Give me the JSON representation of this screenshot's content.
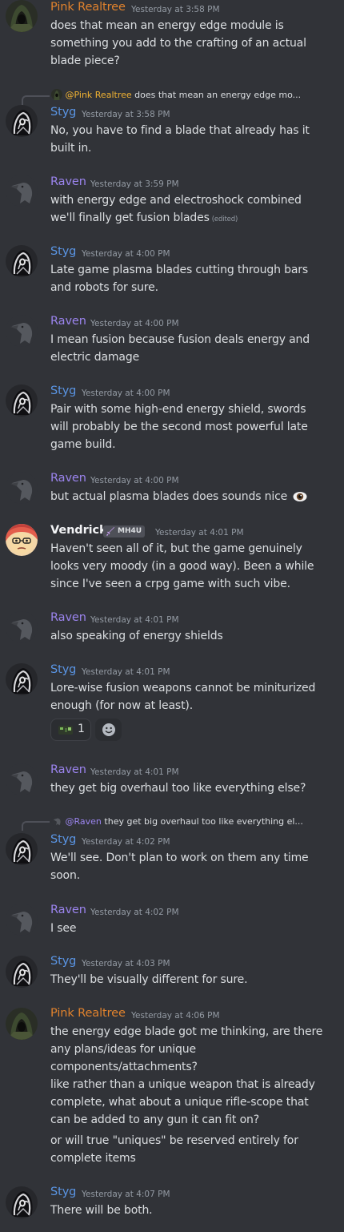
{
  "users": {
    "pink": "Pink Realtree",
    "styg": "Styg",
    "raven": "Raven",
    "vendrick": "Vendrick"
  },
  "badge": {
    "vendrick": "MH4U"
  },
  "messages": [
    {
      "author": "Pink Realtree",
      "time": "Yesterday at 3:58 PM",
      "lines": [
        "does that mean an energy edge module is",
        "something you add to the crafting of an actual",
        "blade piece?"
      ]
    },
    {
      "reply_to": "@Pink Realtree",
      "reply_text": "does that mean an energy edge mo...",
      "author": "Styg",
      "time": "Yesterday at 3:58 PM",
      "lines": [
        "No, you have to find a blade that already has it",
        "built in."
      ]
    },
    {
      "author": "Raven",
      "time": "Yesterday at 3:59 PM",
      "lines": [
        "with energy edge and electroshock combined",
        "we'll finally get fusion blades"
      ],
      "edited": "(edited)"
    },
    {
      "author": "Styg",
      "time": "Yesterday at 4:00 PM",
      "lines": [
        "Late game plasma blades cutting through bars",
        "and robots for sure."
      ]
    },
    {
      "author": "Raven",
      "time": "Yesterday at 4:00 PM",
      "lines": [
        "I mean fusion because fusion deals energy and",
        "electric damage"
      ]
    },
    {
      "author": "Styg",
      "time": "Yesterday at 4:00 PM",
      "lines": [
        "Pair with some high-end energy shield, swords",
        "will probably be the second most powerful late",
        "game build."
      ]
    },
    {
      "author": "Raven",
      "time": "Yesterday at 4:00 PM",
      "lines": [
        "but actual plasma blades does sounds nice"
      ],
      "emoji": "eye-emoji"
    },
    {
      "author": "Vendrick",
      "time": "Yesterday at 4:01 PM",
      "lines": [
        "Haven't seen all of it, but the game genuinely",
        "looks very moody (in a good way). Been a while",
        "since I've seen a crpg game with such vibe."
      ]
    },
    {
      "author": "Raven",
      "time": "Yesterday at 4:01 PM",
      "lines": [
        "also speaking of energy shields"
      ]
    },
    {
      "author": "Styg",
      "time": "Yesterday at 4:01 PM",
      "lines": [
        "Lore-wise fusion weapons cannot be miniturized",
        "enough (for now at least)."
      ],
      "reaction": {
        "icon": "custom-emoji-icon",
        "count": "1"
      }
    },
    {
      "author": "Raven",
      "time": "Yesterday at 4:01 PM",
      "lines": [
        "they get big overhaul too like everything else?"
      ]
    },
    {
      "reply_to": "@Raven",
      "reply_text": "they get big overhaul too like everything el...",
      "author": "Styg",
      "time": "Yesterday at 4:02 PM",
      "lines": [
        "We'll see. Don't plan to work on them any time",
        "soon."
      ]
    },
    {
      "author": "Raven",
      "time": "Yesterday at 4:02 PM",
      "lines": [
        "I see"
      ]
    },
    {
      "author": "Styg",
      "time": "Yesterday at 4:03 PM",
      "lines": [
        "They'll be visually different for sure."
      ]
    },
    {
      "author": "Pink Realtree",
      "time": "Yesterday at 4:06 PM",
      "lines": [
        "the energy edge blade got me thinking, are there",
        "any plans/ideas for unique",
        "components/attachments?",
        "like rather than a unique weapon that is already",
        "complete, what about a unique rifle-scope that",
        "can be added to any gun it can fit on?",
        "or will true \"uniques\" be reserved entirely for",
        "complete items"
      ]
    },
    {
      "author": "Styg",
      "time": "Yesterday at 4:07 PM",
      "lines": [
        "There will be both."
      ]
    }
  ],
  "colors": {
    "background": "#313338",
    "pink_realtree": "#e0822d",
    "styg": "#5a95e4",
    "raven": "#9b84ee",
    "text": "#dbdee1",
    "timestamp": "#949ba4"
  }
}
